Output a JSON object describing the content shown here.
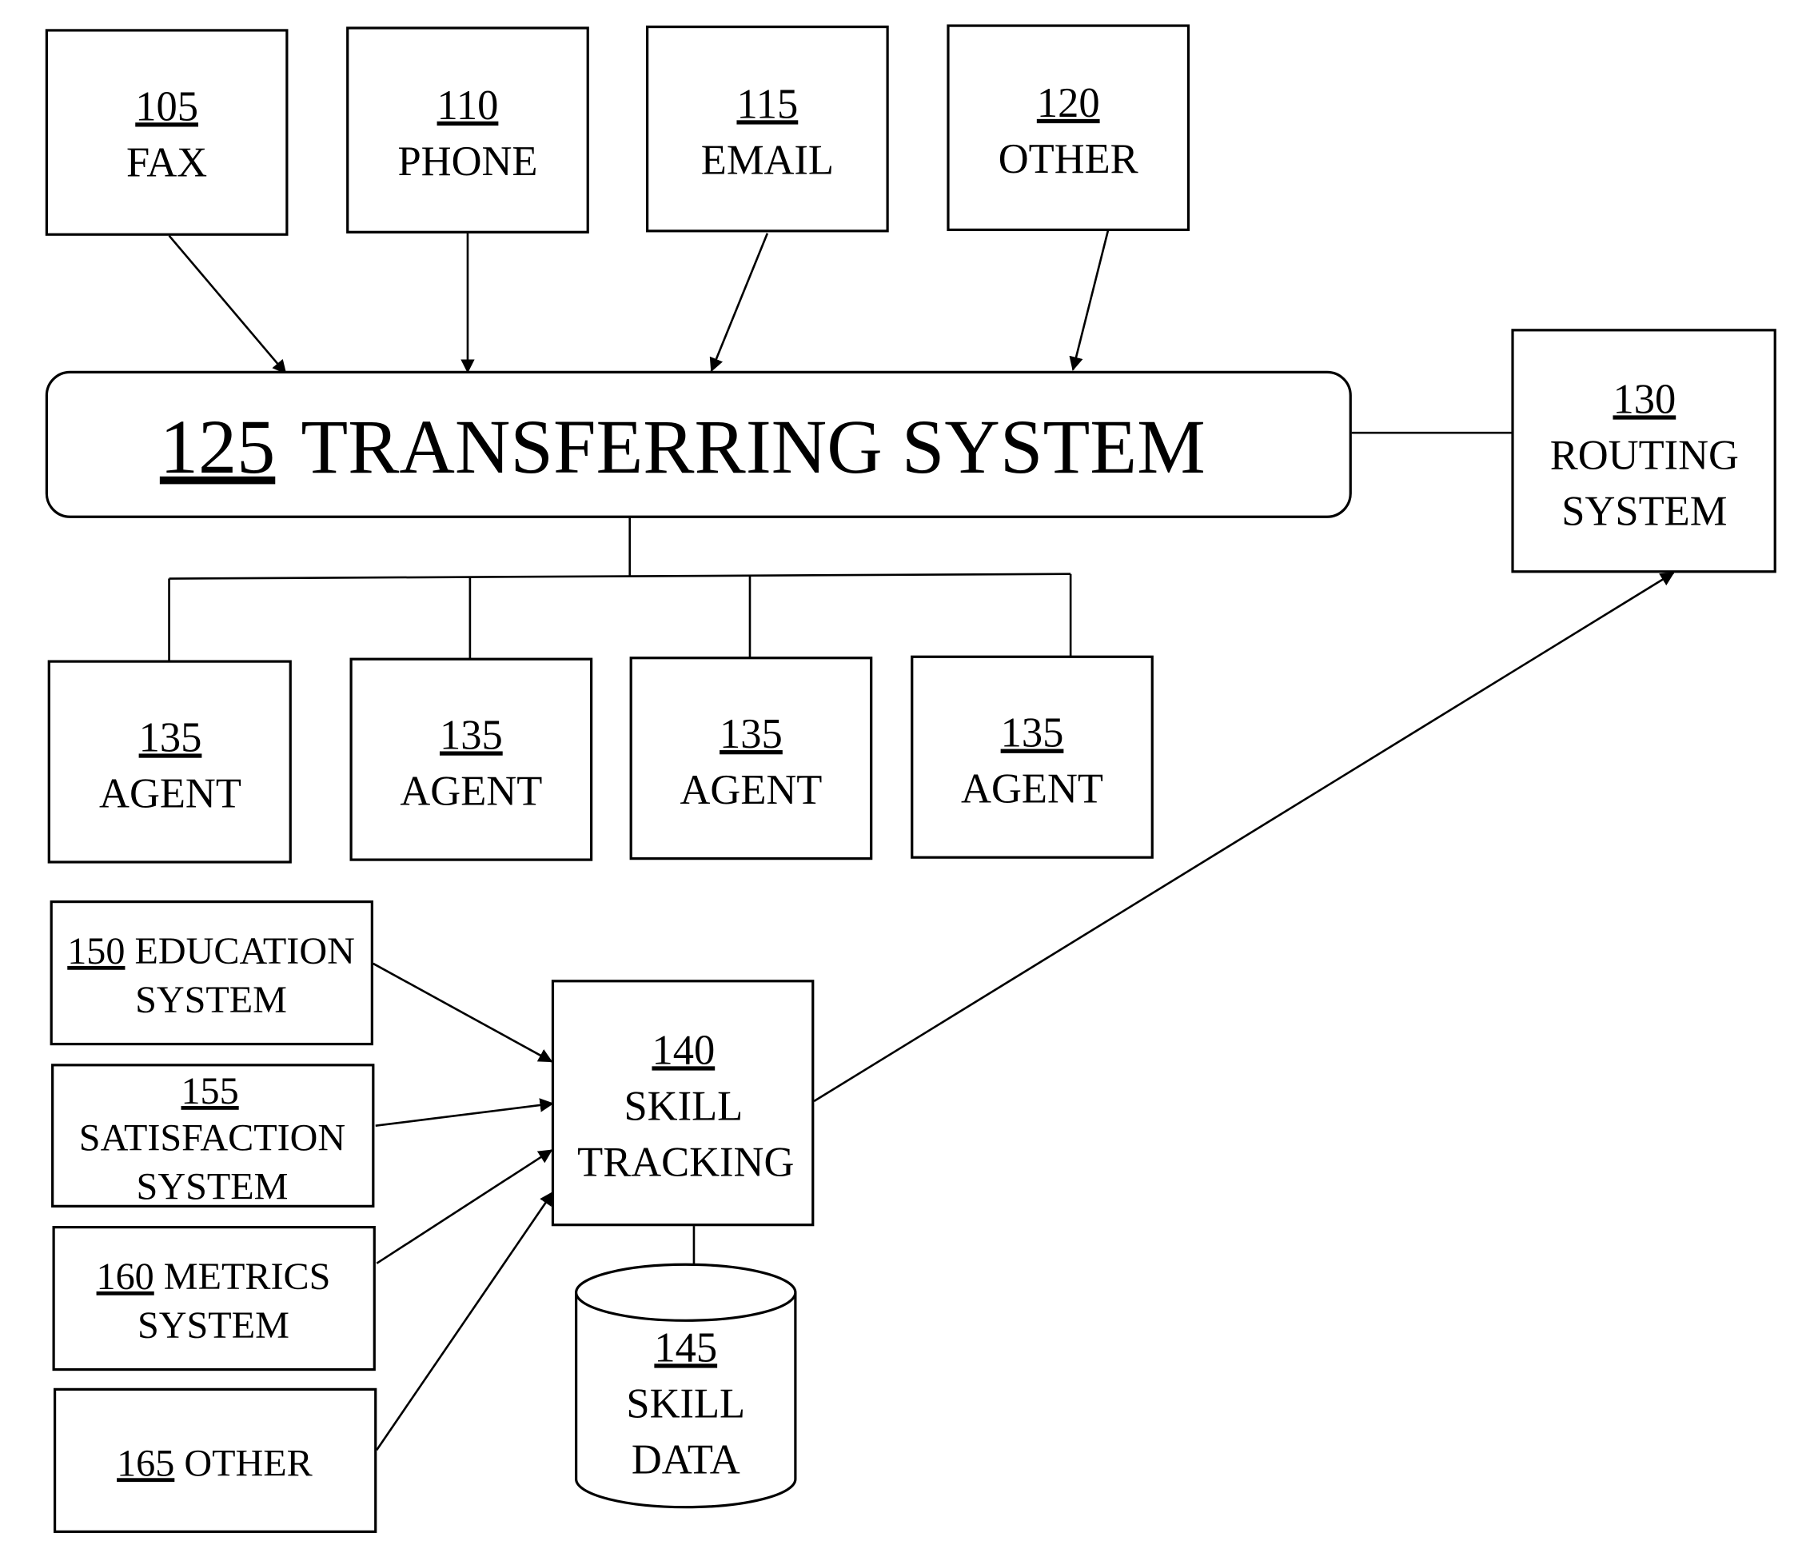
{
  "diagram": {
    "inputs": [
      {
        "ref": "105",
        "label": "FAX"
      },
      {
        "ref": "110",
        "label": "PHONE"
      },
      {
        "ref": "115",
        "label": "EMAIL"
      },
      {
        "ref": "120",
        "label": "OTHER"
      }
    ],
    "transferring": {
      "ref": "125",
      "label": "TRANSFERRING SYSTEM"
    },
    "routing": {
      "ref": "130",
      "line1": "ROUTING",
      "line2": "SYSTEM"
    },
    "agents": [
      {
        "ref": "135",
        "label": "AGENT"
      },
      {
        "ref": "135",
        "label": "AGENT"
      },
      {
        "ref": "135",
        "label": "AGENT"
      },
      {
        "ref": "135",
        "label": "AGENT"
      }
    ],
    "sources": {
      "education": {
        "ref": "150",
        "line1": "EDUCATION",
        "line2": "SYSTEM"
      },
      "satisfaction": {
        "ref": "155",
        "line1": "SATISFACTION",
        "line2": "SYSTEM"
      },
      "metrics": {
        "ref": "160",
        "line1": "METRICS",
        "line2": "SYSTEM"
      },
      "other": {
        "ref": "165",
        "line1": "OTHER"
      }
    },
    "skill_tracking": {
      "ref": "140",
      "line1": "SKILL",
      "line2": "TRACKING"
    },
    "skill_data": {
      "ref": "145",
      "line1": "SKILL",
      "line2": "DATA"
    }
  }
}
